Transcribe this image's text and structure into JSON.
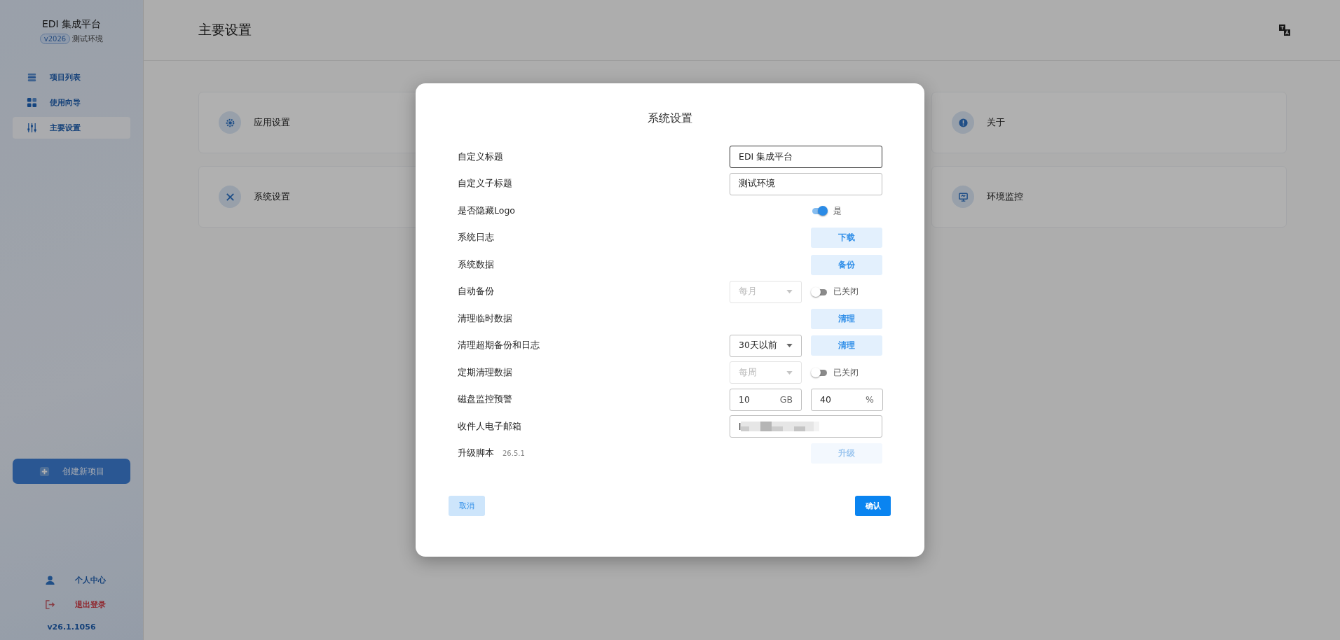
{
  "sidebar": {
    "app_title": "EDI 集成平台",
    "version_badge": "v2026",
    "env_label": "测试环境",
    "nav": [
      {
        "label": "项目列表",
        "selected": false
      },
      {
        "label": "使用向导",
        "selected": false
      },
      {
        "label": "主要设置",
        "selected": true
      }
    ],
    "create_button": "创建新项目",
    "bottom": [
      {
        "label": "个人中心",
        "kind": "user"
      },
      {
        "label": "退出登录",
        "kind": "logout"
      }
    ],
    "app_version": "v26.1.1056"
  },
  "header": {
    "title": "主要设置"
  },
  "cards": [
    {
      "label": "应用设置"
    },
    {
      "label": "关于"
    },
    {
      "label": "系统设置"
    },
    {
      "label": "环境监控"
    }
  ],
  "dialog": {
    "title": "系统设置",
    "rows": [
      {
        "label": "自定义标题",
        "kind": "input",
        "value": "EDI 集成平台",
        "focused": true
      },
      {
        "label": "自定义子标题",
        "kind": "input",
        "value": "测试环境",
        "focused": false
      },
      {
        "label": "是否隐藏Logo",
        "kind": "switch",
        "on": true,
        "state_label": "是"
      },
      {
        "label": "系统日志",
        "kind": "button",
        "button": "下载",
        "disabled": false
      },
      {
        "label": "系统数据",
        "kind": "button",
        "button": "备份",
        "disabled": false
      },
      {
        "label": "自动备份",
        "kind": "select-switch",
        "select": {
          "value": "每月",
          "disabled": true
        },
        "on": false,
        "state_label": "已关闭"
      },
      {
        "label": "清理临时数据",
        "kind": "button",
        "button": "清理",
        "disabled": false
      },
      {
        "label": "清理超期备份和日志",
        "kind": "select-button",
        "select": {
          "value": "30天以前",
          "disabled": false
        },
        "button": "清理",
        "disabled": false
      },
      {
        "label": "定期清理数据",
        "kind": "select-switch",
        "select": {
          "value": "每周",
          "disabled": true
        },
        "on": false,
        "state_label": "已关闭"
      },
      {
        "label": "磁盘监控预警",
        "kind": "pair",
        "fields": [
          {
            "value": "10",
            "unit": "GB"
          },
          {
            "value": "40",
            "unit": "%"
          }
        ]
      },
      {
        "label": "收件人电子邮箱",
        "kind": "email",
        "value": "l"
      },
      {
        "label": "升级脚本",
        "note": "26.5.1",
        "kind": "button",
        "button": "升级",
        "disabled": true
      }
    ],
    "cancel": "取消",
    "confirm": "确认"
  }
}
